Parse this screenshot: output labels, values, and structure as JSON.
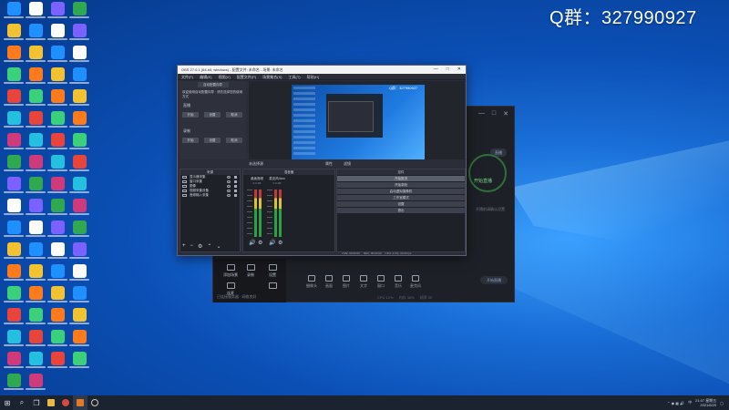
{
  "overlay": {
    "qq_group": "Q群：327990927"
  },
  "obs": {
    "title": "OBS 27.0.1 (64-bit, windows) - 配置文件: 未命名 - 场景: 未命名",
    "menu": [
      "文件(F)",
      "编辑(E)",
      "视图(V)",
      "配置文件(P)",
      "场景集合(S)",
      "工具(T)",
      "帮助(H)"
    ],
    "window_controls": [
      "—",
      "□",
      "✕"
    ],
    "auto_config": {
      "header": "自动配置向导",
      "line1": "欢迎使用自动配置向导 · 请先选择您的使用方式",
      "line2": "直播",
      "btns_a": [
        "开始",
        "设置",
        "取消"
      ],
      "line3": "录制",
      "btns_b": [
        "开始",
        "设置",
        "取消"
      ]
    },
    "preview_labels": {
      "no_source": "未选择源",
      "properties": "属性",
      "filters": "滤镜"
    },
    "preview_q": "Q群：327990927",
    "scenes": {
      "header": "来源",
      "items": [
        "显示器采集",
        "窗口采集",
        "图像",
        "视频采集设备",
        "音频输入采集"
      ],
      "footer_icons": [
        "+",
        "−",
        "⚙",
        "⌃",
        "⌄"
      ]
    },
    "mixer": {
      "header": "混音器",
      "channels": [
        {
          "name": "桌面音频",
          "value": "0.0 dB"
        },
        {
          "name": "麦克风/Aux",
          "value": "0.0 dB"
        }
      ]
    },
    "controls": {
      "header": "控件",
      "buttons": [
        "开始推流",
        "开始录制",
        "启动虚拟摄像机",
        "工作室模式",
        "设置",
        "退出"
      ]
    },
    "status": [
      "LIVE: 00:00:00",
      "REC: 00:00:00",
      "CPU: 2.3%, 30.00 fps"
    ]
  },
  "bg_app": {
    "top_controls": [
      "—",
      "□",
      "✕"
    ],
    "live_badge": "直播",
    "ring_label": "开始直播",
    "ring_sub": "开播前请确认设置",
    "left_buttons": [
      "添加场景",
      "录制",
      "设置",
      "连麦"
    ],
    "tools": [
      "摄像头",
      "画面",
      "图片",
      "文字",
      "窗口",
      "音乐",
      "麦克风"
    ],
    "golive": "开始直播",
    "status": "已连接服务器 · 网络良好",
    "stats": [
      "CPU 12%",
      "内存 38%",
      "帧率 30"
    ]
  },
  "taskbar": {
    "time": "21:07 星期五",
    "date": "2021/8/20",
    "tray_text": "中"
  }
}
